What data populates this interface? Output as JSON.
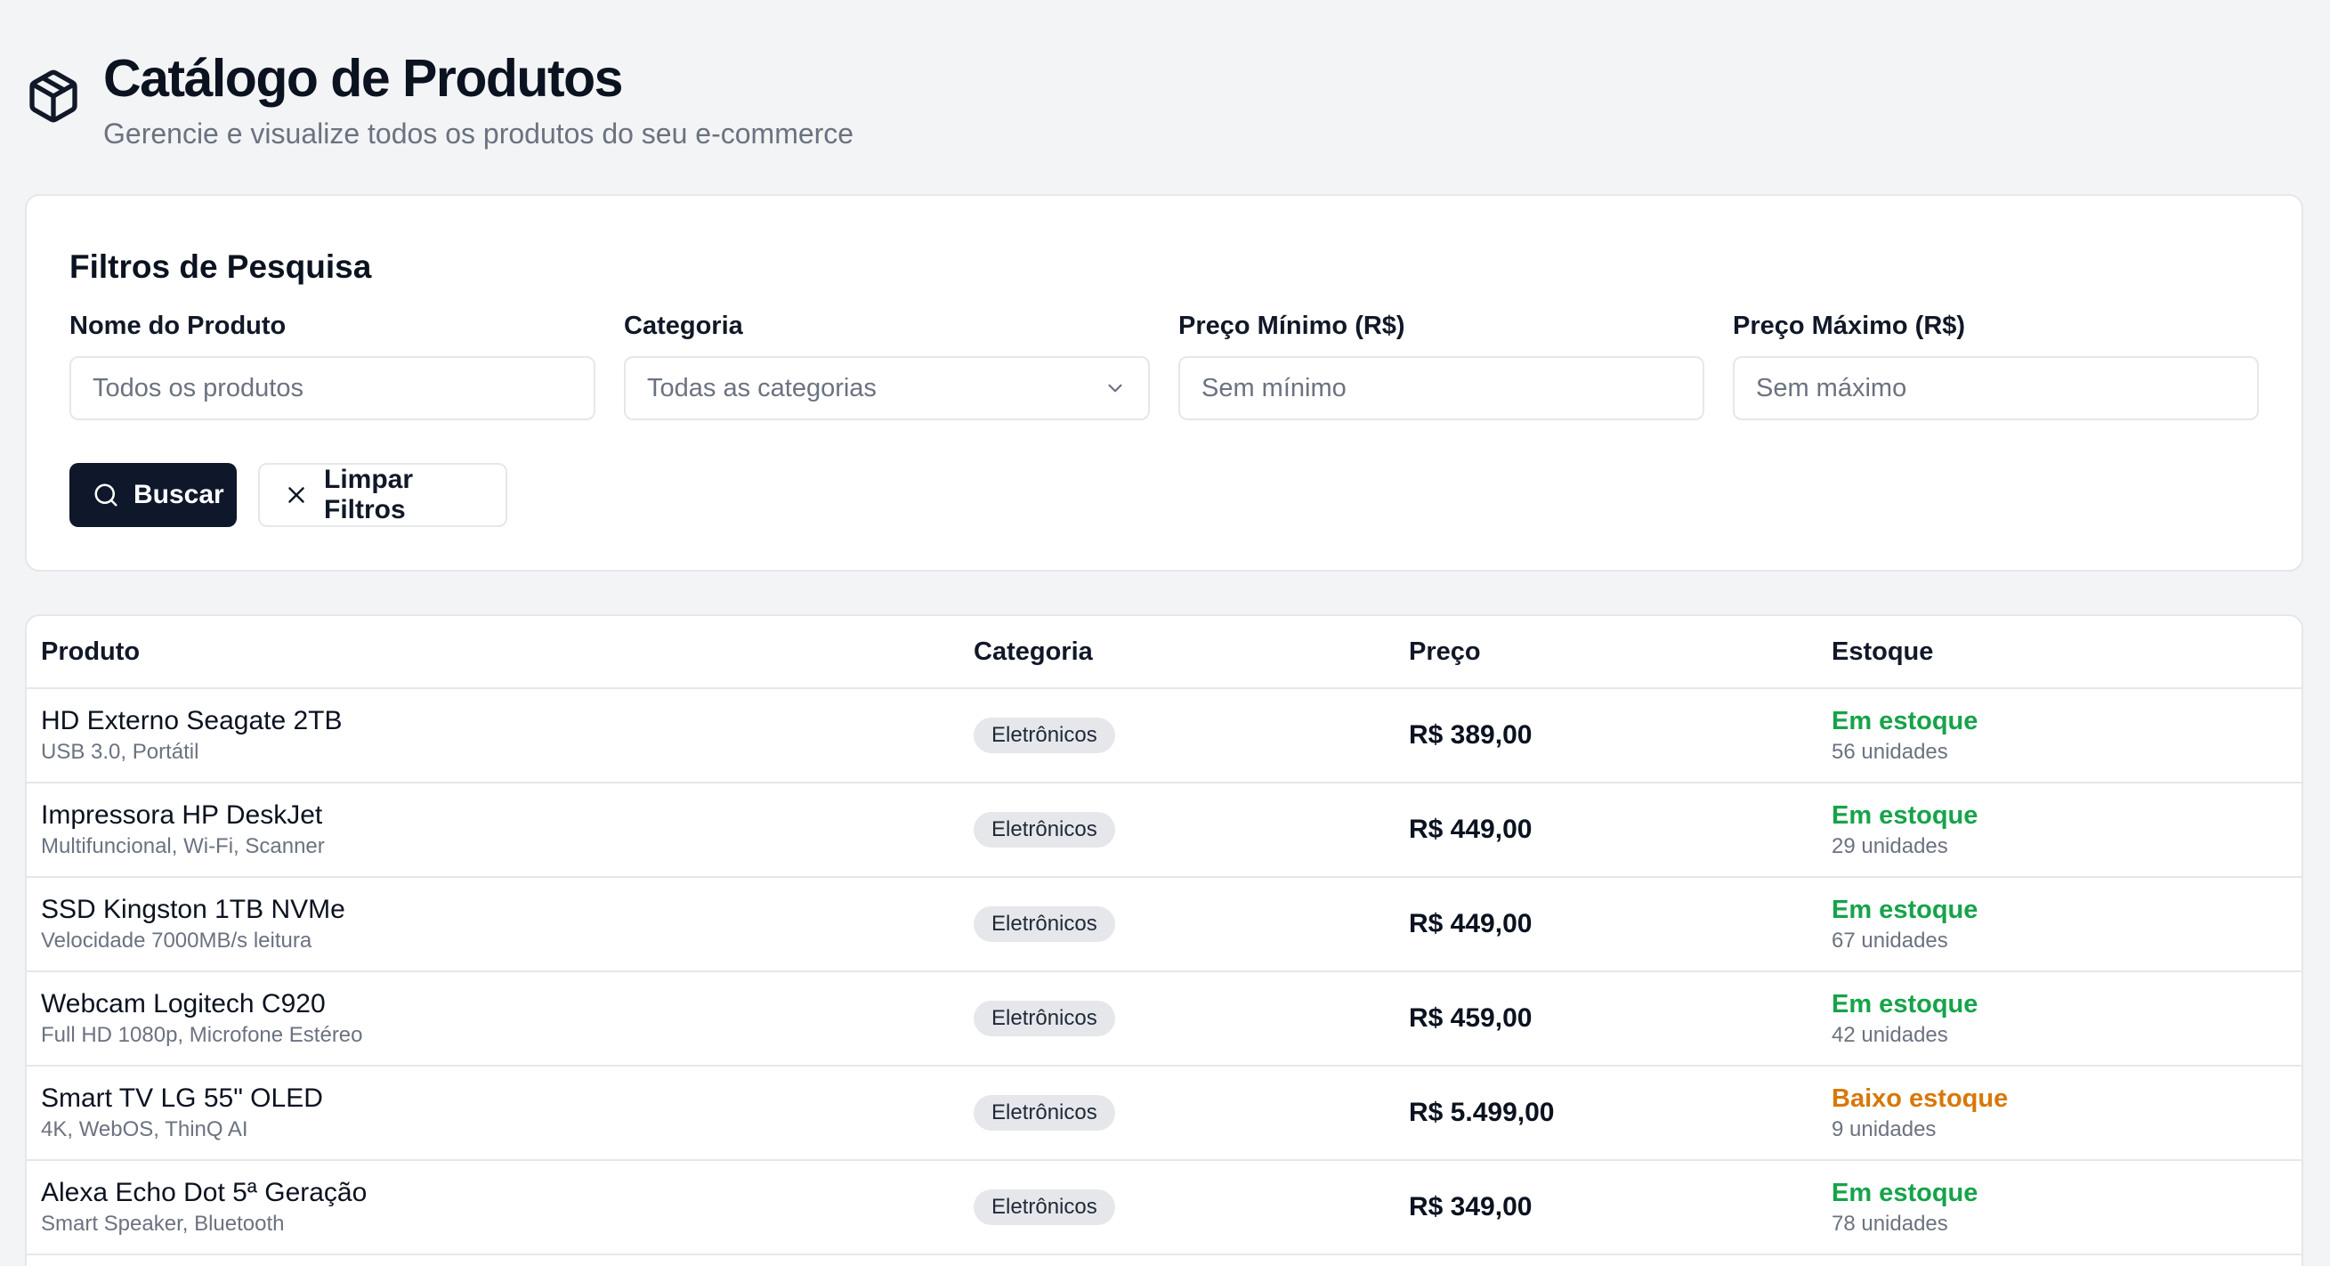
{
  "header": {
    "title": "Catálogo de Produtos",
    "subtitle": "Gerencie e visualize todos os produtos do seu e-commerce",
    "icon": "package-icon"
  },
  "filters": {
    "title": "Filtros de Pesquisa",
    "name": {
      "label": "Nome do Produto",
      "placeholder": "Todos os produtos"
    },
    "category": {
      "label": "Categoria",
      "value": "Todas as categorias"
    },
    "min_price": {
      "label": "Preço Mínimo (R$)",
      "placeholder": "Sem mínimo"
    },
    "max_price": {
      "label": "Preço Máximo (R$)",
      "placeholder": "Sem máximo"
    },
    "search_label": "Buscar",
    "clear_label": "Limpar Filtros"
  },
  "table": {
    "columns": [
      "Produto",
      "Categoria",
      "Preço",
      "Estoque"
    ],
    "rows": [
      {
        "name": "HD Externo Seagate 2TB",
        "desc": "USB 3.0, Portátil",
        "category": "Eletrônicos",
        "price": "R$ 389,00",
        "status": "Em estoque",
        "units": "56 unidades"
      },
      {
        "name": "Impressora HP DeskJet",
        "desc": "Multifuncional, Wi-Fi, Scanner",
        "category": "Eletrônicos",
        "price": "R$ 449,00",
        "status": "Em estoque",
        "units": "29 unidades"
      },
      {
        "name": "SSD Kingston 1TB NVMe",
        "desc": "Velocidade 7000MB/s leitura",
        "category": "Eletrônicos",
        "price": "R$ 449,00",
        "status": "Em estoque",
        "units": "67 unidades"
      },
      {
        "name": "Webcam Logitech C920",
        "desc": "Full HD 1080p, Microfone Estéreo",
        "category": "Eletrônicos",
        "price": "R$ 459,00",
        "status": "Em estoque",
        "units": "42 unidades"
      },
      {
        "name": "Smart TV LG 55\" OLED",
        "desc": "4K, WebOS, ThinQ AI",
        "category": "Eletrônicos",
        "price": "R$ 5.499,00",
        "status": "Baixo estoque",
        "units": "9 unidades"
      },
      {
        "name": "Alexa Echo Dot 5ª Geração",
        "desc": "Smart Speaker, Bluetooth",
        "category": "Eletrônicos",
        "price": "R$ 349,00",
        "status": "Em estoque",
        "units": "78 unidades"
      }
    ]
  },
  "colors": {
    "primary": "#0f172a",
    "in_stock": "#16a34a",
    "low_stock": "#d97706"
  }
}
